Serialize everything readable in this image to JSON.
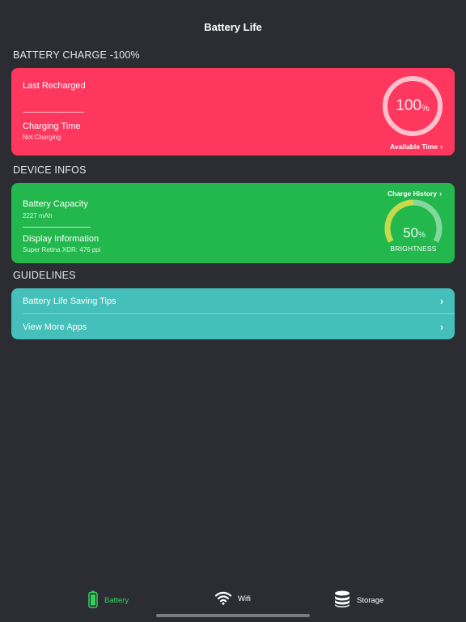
{
  "header": {
    "title": "Battery Life"
  },
  "battery_section": {
    "title": "BATTERY CHARGE -100%",
    "last_recharged_label": "Last Recharged",
    "charging_time_label": "Charging Time",
    "charging_status": "Not Charging",
    "charge_value": "100",
    "charge_unit": "%",
    "charge_fraction": 1.0,
    "available_time_label": "Available Time"
  },
  "device_section": {
    "title": "DEVICE INFOS",
    "charge_history_label": "Charge History",
    "capacity_label": "Battery Capacity",
    "capacity_value": "2227 mAh",
    "display_label": "Display Information",
    "display_value": "Super Retina XDR: 476 ppi",
    "brightness_value": "50",
    "brightness_unit": "%",
    "brightness_fraction": 0.5,
    "brightness_label": "BRIGHTNESS"
  },
  "guidelines_section": {
    "title": "GUIDELINES",
    "items": [
      {
        "label": "Battery Life Saving Tips"
      },
      {
        "label": "View More Apps"
      }
    ]
  },
  "tabs": [
    {
      "label": "Battery",
      "icon": "battery-icon",
      "active": true
    },
    {
      "label": "Wifi",
      "icon": "wifi-icon",
      "active": false
    },
    {
      "label": "Storage",
      "icon": "storage-icon",
      "active": false
    }
  ],
  "colors": {
    "background": "#2c2d33",
    "battery_card": "#fe375f",
    "device_card": "#22b84d",
    "guidelines_card": "#44bfb9",
    "active_tab": "#30d158"
  }
}
